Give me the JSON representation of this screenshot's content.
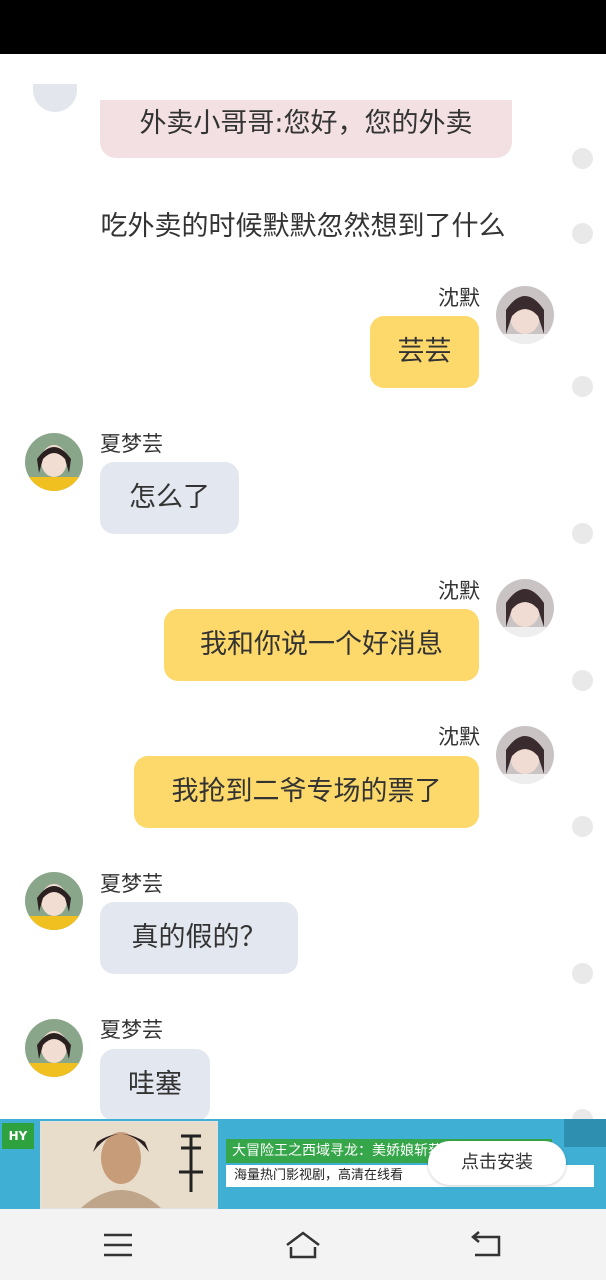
{
  "chat": {
    "partial_message": "外卖小哥哥:您好，您的外卖",
    "narration": "吃外卖的时候默默忽然想到了什么",
    "messages": [
      {
        "sender": "沈默",
        "text": "芸芸"
      },
      {
        "sender": "夏梦芸",
        "text": "怎么了"
      },
      {
        "sender": "沈默",
        "text": "我和你说一个好消息"
      },
      {
        "sender": "沈默",
        "text": "我抢到二爷专场的票了"
      },
      {
        "sender": "夏梦芸",
        "text": "真的假的？"
      },
      {
        "sender": "夏梦芸",
        "text": "哇塞"
      }
    ]
  },
  "ad": {
    "logo_text": "HY",
    "title": "大冒险王之西域寻龙：美娇娘斩获",
    "subtitle": "海量热门影视剧，高清在线看",
    "install_label": "点击安装"
  },
  "colors": {
    "my_bubble": "#fcd96a",
    "their_bubble": "#e3e7ef",
    "partial_bubble": "#f2e0e2",
    "ad_background": "#3fb0d4"
  },
  "nav": {
    "icons": [
      "menu-icon",
      "home-icon",
      "back-icon"
    ]
  }
}
